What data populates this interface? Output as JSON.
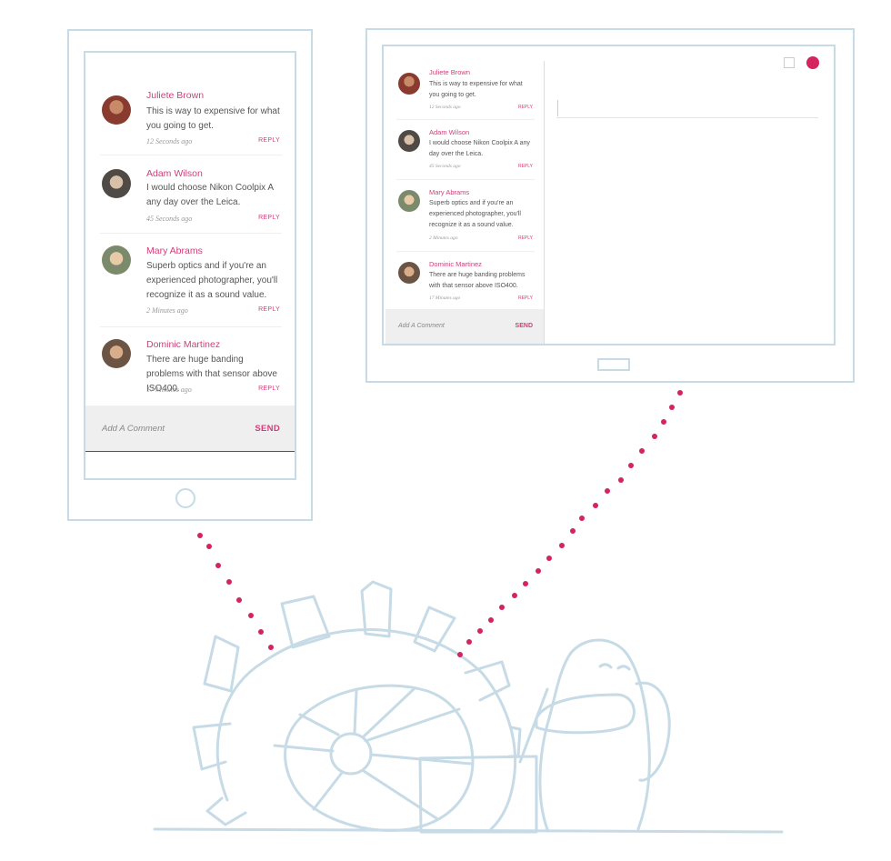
{
  "colors": {
    "accent": "#d23d7a",
    "outline": "#c6dbe6",
    "dots": "#d4245f",
    "comment_bg": "#efefef"
  },
  "comments": [
    {
      "name": "Juliete Brown",
      "text": "This is way to expensive for what you going to get.",
      "time": "12 Seconds ago",
      "reply": "REPLY",
      "avatar_color": "#8a3b2f"
    },
    {
      "name": "Adam Wilson",
      "text": "I would choose Nikon Coolpix A any day over the Leica.",
      "time": "45 Seconds ago",
      "reply": "REPLY",
      "avatar_color": "#4f4a45"
    },
    {
      "name": "Mary Abrams",
      "text": "Superb optics and if you're an experienced photographer, you'll recognize it as a sound value.",
      "time": "2 Minutes ago",
      "reply": "REPLY",
      "avatar_color": "#7a8a6a"
    },
    {
      "name": "Dominic Martinez",
      "text": "There are huge banding problems with that sensor above ISO400.",
      "time": "17 Minutes ago",
      "reply": "REPLY",
      "avatar_color": "#6b5444"
    }
  ],
  "tablet_times": [
    "12 Seconds ago",
    "45 Seconds ago",
    "2 Minutes ago",
    "17 Minutes ago"
  ],
  "comment_box": {
    "placeholder": "Add A Comment",
    "send_label": "SEND"
  }
}
